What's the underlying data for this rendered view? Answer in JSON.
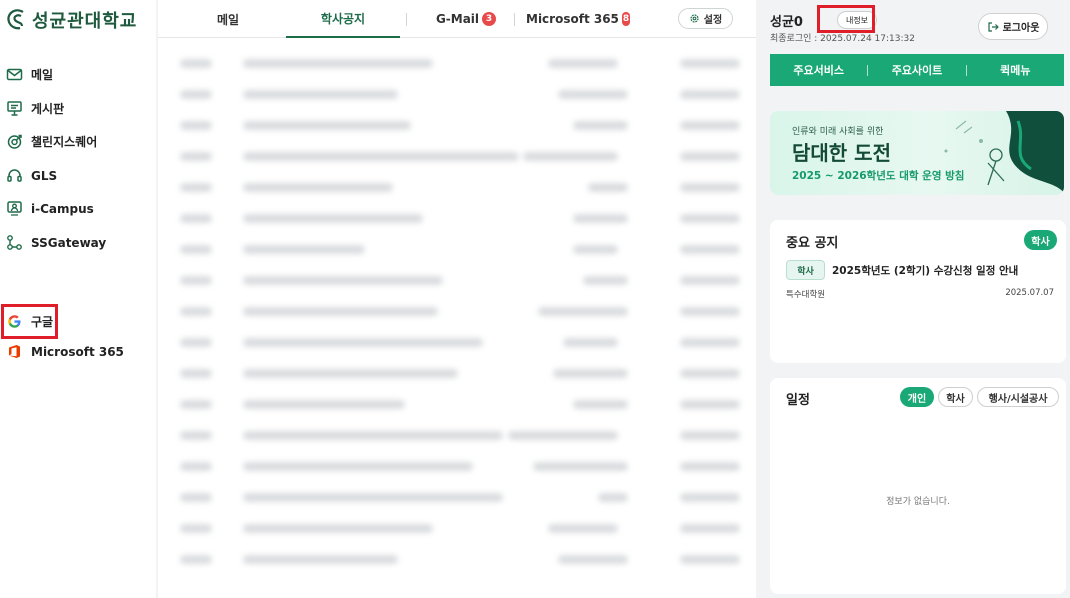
{
  "logo": {
    "text": "성균관대학교"
  },
  "sidebar": {
    "items": [
      {
        "label": "메일",
        "icon": "mail-icon"
      },
      {
        "label": "게시판",
        "icon": "board-icon"
      },
      {
        "label": "챌린지스퀘어",
        "icon": "challenge-icon"
      },
      {
        "label": "GLS",
        "icon": "headset-icon"
      },
      {
        "label": "i-Campus",
        "icon": "monitor-user-icon"
      },
      {
        "label": "SSGateway",
        "icon": "network-icon"
      },
      {
        "label": "구글",
        "icon": "google-icon"
      },
      {
        "label": "Microsoft 365",
        "icon": "office-icon"
      }
    ]
  },
  "tabs": [
    {
      "label": "메일"
    },
    {
      "label": "학사공지",
      "active": true
    },
    {
      "label": "G-Mail",
      "badge": "3"
    },
    {
      "label": "Microsoft 365",
      "badge": "8"
    }
  ],
  "settings_label": "설정",
  "user": {
    "name": "성균0",
    "my_info_label": "내정보",
    "last_login": "최종로그인 : 2025.07.24 17:13:32",
    "logout_label": "로그아웃"
  },
  "quick_menu": [
    "주요서비스",
    "주요사이트",
    "퀵메뉴"
  ],
  "banner": {
    "line1": "인류와 미래 사회를 위한",
    "line2": "담대한 도전",
    "line3": "2025 ~ 2026학년도 대학 운영 방침"
  },
  "important_notice": {
    "title": "중요 공지",
    "filter_label": "학사",
    "item": {
      "tag": "학사",
      "title": "2025학년도 (2학기) 수강신청 일정 안내",
      "dept": "특수대학원",
      "date": "2025.07.07"
    }
  },
  "schedule": {
    "title": "일정",
    "filters": [
      "개인",
      "학사",
      "행사/시설공사"
    ],
    "empty_text": "정보가 없습니다."
  },
  "colors": {
    "brand_green": "#1aa877",
    "dark_green": "#1e6b4a",
    "badge_red": "#e84a4a",
    "highlight_red": "#e01e2a"
  }
}
